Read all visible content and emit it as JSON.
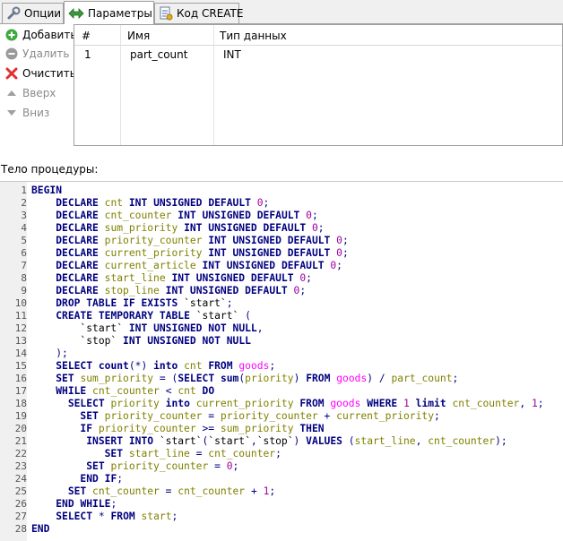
{
  "tabs": [
    {
      "label": "Опции",
      "icon": "wrench-icon"
    },
    {
      "label": "Параметры",
      "icon": "arrows-icon"
    },
    {
      "label": "Код CREATE",
      "icon": "code-page-icon"
    }
  ],
  "side_buttons": {
    "add": "Добавить",
    "delete": "Удалить",
    "clear": "Очистить",
    "up": "Вверх",
    "down": "Вниз"
  },
  "params_table": {
    "headers": [
      "#",
      "Имя",
      "Тип данных"
    ],
    "rows": [
      {
        "num": "1",
        "name": "part_count",
        "type": "INT"
      }
    ]
  },
  "body_label": "Тело процедуры:",
  "code_lines": [
    "BEGIN",
    "    DECLARE cnt INT UNSIGNED DEFAULT 0;",
    "    DECLARE cnt_counter INT UNSIGNED DEFAULT 0;",
    "    DECLARE sum_priority INT UNSIGNED DEFAULT 0;",
    "    DECLARE priority_counter INT UNSIGNED DEFAULT 0;",
    "    DECLARE current_priority INT UNSIGNED DEFAULT 0;",
    "    DECLARE current_article INT UNSIGNED DEFAULT 0;",
    "    DECLARE start_line INT UNSIGNED DEFAULT 0;",
    "    DECLARE stop_line INT UNSIGNED DEFAULT 0;",
    "    DROP TABLE IF EXISTS `start`;",
    "    CREATE TEMPORARY TABLE `start` (",
    "        `start` INT UNSIGNED NOT NULL,",
    "        `stop` INT UNSIGNED NOT NULL",
    "    );",
    "    SELECT count(*) into cnt FROM goods;",
    "    SET sum_priority = (SELECT sum(priority) FROM goods) / part_count;",
    "    WHILE cnt_counter < cnt DO",
    "      SELECT priority into current_priority FROM goods WHERE 1 limit cnt_counter, 1;",
    "        SET priority_counter = priority_counter + current_priority;",
    "        IF priority_counter >= sum_priority THEN",
    "         INSERT INTO `start`(`start`,`stop`) VALUES (start_line, cnt_counter);",
    "            SET start_line = cnt_counter;",
    "         SET priority_counter = 0;",
    "        END IF;",
    "      SET cnt_counter = cnt_counter + 1;",
    "    END WHILE;",
    "    SELECT * FROM start;",
    "END"
  ]
}
